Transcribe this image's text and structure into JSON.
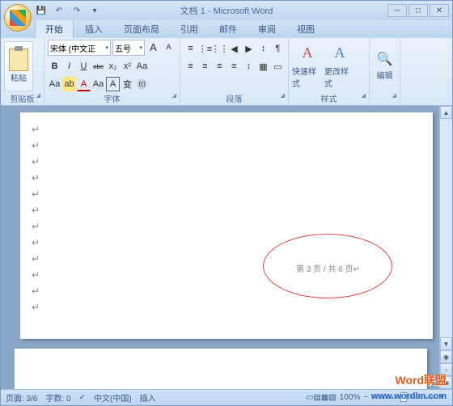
{
  "title": "文档 1 - Microsoft Word",
  "qat": {
    "save": "💾",
    "undo": "↶",
    "redo": "↷",
    "more": "▾"
  },
  "win": {
    "min": "─",
    "max": "□",
    "close": "✕"
  },
  "tabs": [
    "开始",
    "插入",
    "页面布局",
    "引用",
    "邮件",
    "审阅",
    "视图"
  ],
  "active_tab": 0,
  "ribbon": {
    "clipboard": {
      "label": "剪贴板",
      "paste": "粘贴"
    },
    "font": {
      "label": "字体",
      "family": "宋体 (中文正",
      "size": "五号",
      "grow": "A",
      "shrink": "A",
      "clear": "Aa",
      "bold": "B",
      "italic": "I",
      "underline": "U",
      "strike": "abc",
      "sub": "x₂",
      "sup": "x²",
      "case": "Aa",
      "highlight": "ab",
      "color": "A"
    },
    "paragraph": {
      "label": "段落",
      "bullets": "≡",
      "numbers": "⋮≡",
      "multilevel": "⋮⋮",
      "dedent": "◀",
      "indent": "▶",
      "left": "≡",
      "center": "≡",
      "right": "≡",
      "justify": "≡",
      "spacing": "↕",
      "shading": "▦",
      "border": "▭",
      "sort": "↕",
      "marks": "¶"
    },
    "styles": {
      "label": "样式",
      "quick": "快速样式",
      "change": "更改样式"
    },
    "editing": {
      "label": "编辑"
    }
  },
  "document": {
    "footer_text": "第 3 页 / 共 6 页",
    "para_marks_y": [
      14,
      34,
      54,
      74,
      94,
      114,
      134,
      154,
      174,
      194,
      214,
      234
    ]
  },
  "statusbar": {
    "page": "页面: 3/6",
    "words": "字数: 0",
    "lang": "中文(中国)",
    "mode": "插入",
    "zoom": "100%"
  },
  "watermark": {
    "brand": "Word联盟",
    "url": "www.wordlm.com"
  }
}
